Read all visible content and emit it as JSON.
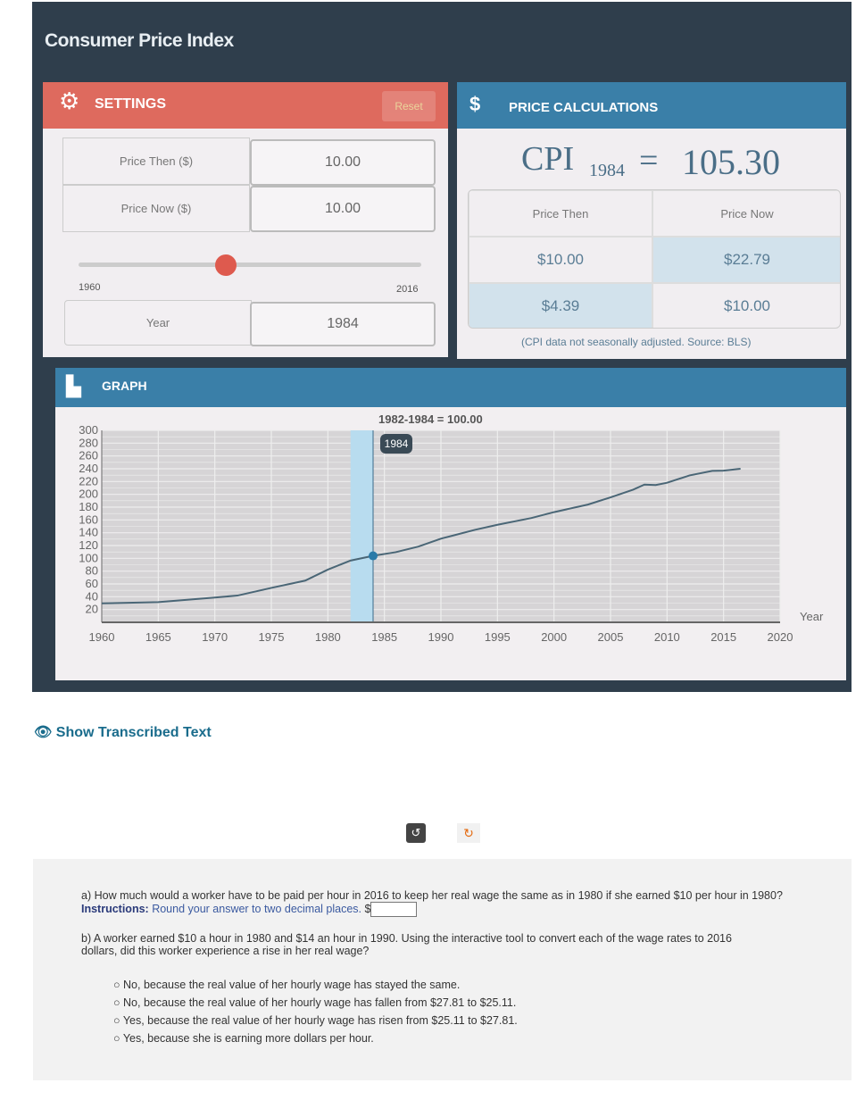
{
  "app_title": "Consumer Price Index",
  "settings": {
    "title": "SETTINGS",
    "reset_label": "Reset",
    "price_then_label": "Price Then ($)",
    "price_then_value": "10.00",
    "price_now_label": "Price Now ($)",
    "price_now_value": "10.00",
    "slider_min": "1960",
    "slider_max": "2016",
    "slider_value": 1984,
    "year_label": "Year",
    "year_value": "1984",
    "accent": "#de6a5e"
  },
  "calculations": {
    "title": "PRICE CALCULATIONS",
    "cpi_label": "CPI",
    "cpi_year": "1984",
    "equals": "=",
    "cpi_value": "105.30",
    "col_then": "Price Then",
    "col_now": "Price Now",
    "row1_then": "$10.00",
    "row1_now": "$22.79",
    "row2_then": "$4.39",
    "row2_now": "$10.00",
    "note": "(CPI data not seasonally adjusted. Source: BLS)"
  },
  "graph": {
    "title": "GRAPH"
  },
  "chart_data": {
    "type": "line",
    "title": "1982-1984 = 100.00",
    "xlabel": "Year",
    "ylabel": "",
    "xlim": [
      1960,
      2020
    ],
    "ylim": [
      0,
      300
    ],
    "x_ticks": [
      "1960",
      "1965",
      "1970",
      "1975",
      "1980",
      "1985",
      "1990",
      "1995",
      "2000",
      "2005",
      "2010",
      "2015",
      "2020"
    ],
    "y_ticks": [
      "20",
      "40",
      "60",
      "80",
      "100",
      "120",
      "140",
      "160",
      "180",
      "200",
      "220",
      "240",
      "260",
      "280",
      "300"
    ],
    "highlight_range": [
      1982,
      1984
    ],
    "marker_year": "1984",
    "marker_value": 103.9,
    "grid": true,
    "x": [
      1960,
      1965,
      1970,
      1972,
      1975,
      1978,
      1980,
      1982,
      1984,
      1986,
      1988,
      1990,
      1993,
      1995,
      1998,
      2000,
      2003,
      2005,
      2007,
      2008,
      2009,
      2010,
      2012,
      2014,
      2015,
      2016.5
    ],
    "values": [
      29.6,
      31.5,
      38.8,
      41.8,
      53.8,
      65.2,
      82.4,
      96.5,
      103.9,
      109.6,
      118.3,
      130.7,
      144.5,
      152.4,
      163,
      172.2,
      184,
      195.3,
      207.3,
      215.3,
      214.5,
      218.1,
      229.6,
      236.7,
      237,
      240
    ]
  },
  "show_transcribed": "Show Transcribed Text",
  "question": {
    "a_text": "a) How much would a worker have to be paid per hour in 2016 to keep her real wage the same as in 1980 if she earned $10 per hour in 1980?",
    "a_instr_label": "Instructions:",
    "a_instr": "Round your answer to two decimal places.",
    "a_currency": "$",
    "a_value": "",
    "b_text": "b) A worker earned $10 a hour in 1980 and $14 an hour in 1990. Using the interactive tool to convert each of the wage rates to 2016 dollars, did this worker experience a rise in her real wage?",
    "options": [
      "No, because the real value of her hourly wage has stayed the same.",
      "No, because the real value of her hourly wage has fallen from $27.81 to $25.11.",
      "Yes, because the real value of her hourly wage has risen from $25.11 to $27.81.",
      "Yes, because she is earning more dollars per hour."
    ]
  }
}
